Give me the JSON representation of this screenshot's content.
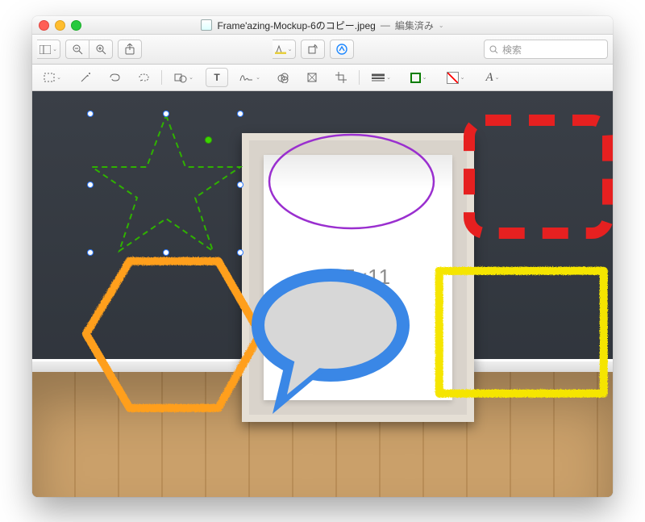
{
  "title": {
    "filename": "Frame'azing-Mockup-6のコピー.jpeg",
    "status": "編集済み"
  },
  "toolbar": {
    "search_placeholder": "検索"
  },
  "canvas": {
    "frame_label": "8.5x11"
  },
  "shapes": {
    "star": {
      "kind": "star",
      "color": "#2fb200",
      "stroke": "dashed"
    },
    "ellipse": {
      "kind": "ellipse",
      "color": "#9a2fcf",
      "stroke": "solid"
    },
    "rect": {
      "kind": "rect",
      "color": "#e62020",
      "stroke": "dashed",
      "corner_radius": 20
    },
    "hexagon": {
      "kind": "hexagon",
      "color": "#ff9f1b",
      "stroke": "crayon"
    },
    "rect2": {
      "kind": "rect",
      "color": "#f5e500",
      "stroke": "crayon"
    },
    "speech": {
      "kind": "speech-bubble",
      "stroke_color": "#3a87e6",
      "fill": "#d7d7d7"
    }
  },
  "markup_toolbar_icons": [
    "select-rect",
    "magic-wand",
    "lasso",
    "smart-lasso",
    "shapes",
    "text",
    "signature",
    "adjust-color",
    "crop-rotate",
    "line-style",
    "border-color",
    "fill-color",
    "text-style"
  ]
}
